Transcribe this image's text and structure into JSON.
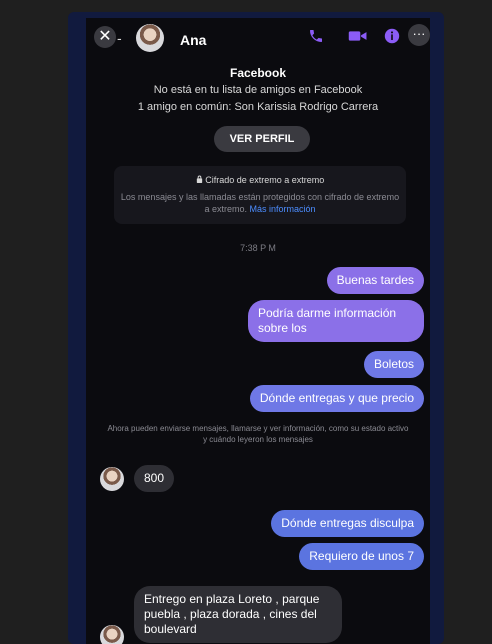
{
  "header": {
    "close_symbol": "✕",
    "dash": "-",
    "contact_name": "Ana",
    "more_symbol": "···",
    "icons": [
      "close-icon",
      "avatar",
      "phone-icon",
      "video-icon",
      "info-icon",
      "more-icon"
    ]
  },
  "profile": {
    "source": "Facebook",
    "not_friends": "No está en tu lista de amigos en Facebook",
    "mutual": "1 amigo en común: Son Karissia Rodrigo Carrera",
    "button_label": "VER PERFIL"
  },
  "encryption": {
    "title": "Cifrado de extremo a extremo",
    "body": "Los mensajes y las llamadas están protegidos con cifrado de extremo a extremo.",
    "link": "Más información"
  },
  "timestamp": "7:38 P M",
  "outgoing_1": [
    "Buenas tardes",
    "Podría darme información sobre los",
    "Boletos",
    "Dónde entregas y que precio"
  ],
  "notice": "Ahora pueden enviarse mensajes, llamarse y ver información, como su estado activo y cuándo leyeron los mensajes",
  "incoming_1": "800",
  "outgoing_2": [
    "Dónde entregas disculpa",
    "Requiero de unos 7"
  ],
  "incoming_2": "Entrego en plaza Loreto , parque puebla , plaza dorada , cines del boulevard",
  "colors": {
    "outgoing_top": "#8b70e8",
    "outgoing_bottom": "#5b74e0",
    "incoming": "#2e2e34",
    "accent": "#8b5cf6"
  }
}
